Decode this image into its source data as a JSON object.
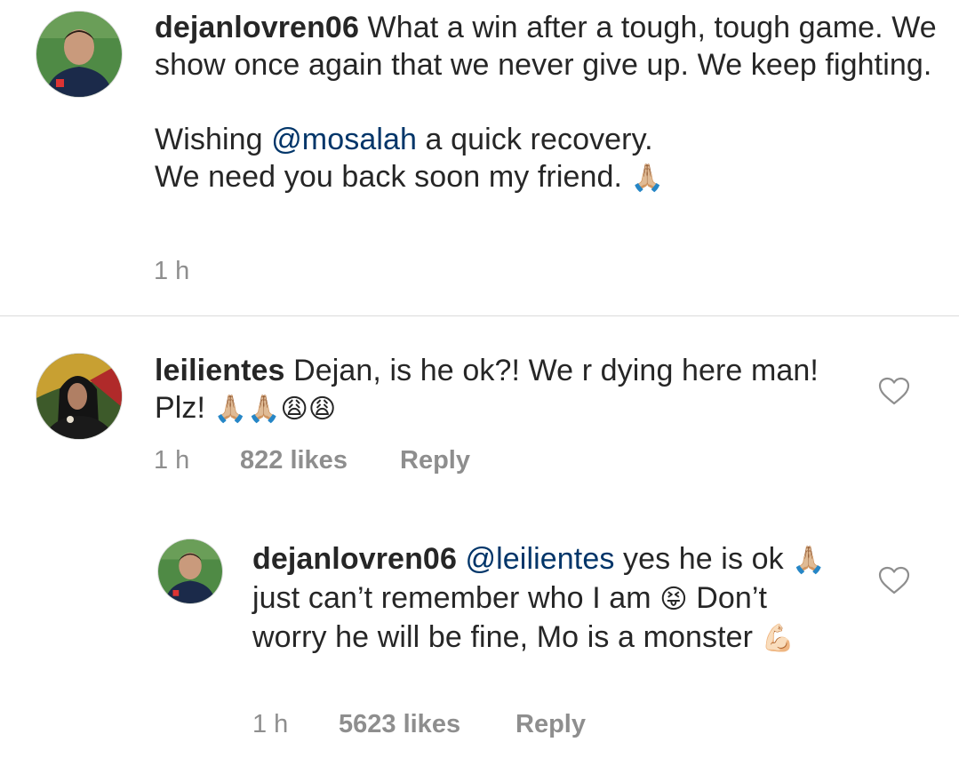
{
  "caption": {
    "username": "dejanlovren06",
    "line1": "What a win after a tough, tough game. We show once again that we never give up. We keep fighting.",
    "line2_pre": "Wishing ",
    "line2_mention": "@mosalah",
    "line2_post": " a quick recovery.",
    "line3": "We need you back soon my friend.",
    "line3_emoji": "🙏🏼",
    "time": "1 h"
  },
  "comments": [
    {
      "username": "leilientes",
      "text": "Dejan, is he ok?! We r dying here man! Plz!",
      "emoji": "🙏🏼🙏🏼😩😩",
      "time": "1 h",
      "likes": "822 likes",
      "reply": "Reply",
      "like_icon": "heart-outline-icon"
    },
    {
      "username": "dejanlovren06",
      "mention": "@leilientes",
      "text_a": "yes he is ok",
      "emoji_a": "🙏🏼",
      "text_b": "just can’t remember who I am",
      "emoji_b": "😝",
      "text_c": "Don’t worry he will be fine, Mo is a monster",
      "emoji_c": "💪🏻",
      "time": "1 h",
      "likes": "5623 likes",
      "reply": "Reply",
      "like_icon": "heart-outline-icon"
    }
  ],
  "colors": {
    "text": "#262626",
    "mention": "#003569",
    "meta": "#8e8e8e",
    "divider": "#dbdbdb"
  }
}
